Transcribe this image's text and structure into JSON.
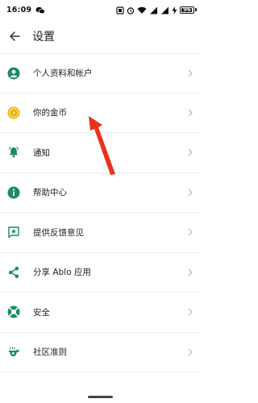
{
  "status_bar": {
    "time": "16:09",
    "battery_level": "96",
    "icons": [
      "wechat-icon",
      "notification-icon",
      "alarm-icon",
      "wifi-icon",
      "signal-icon",
      "signal-icon",
      "charging-icon",
      "battery-icon"
    ]
  },
  "header": {
    "title": "设置",
    "back_icon": "back-arrow-icon"
  },
  "accent_color": "#1b8a6b",
  "coin_color": "#e8b400",
  "annotation_color": "#e8321e",
  "menu": [
    {
      "label": "个人资料和帐户",
      "icon": "account-icon"
    },
    {
      "label": "你的金币",
      "icon": "coin-icon"
    },
    {
      "label": "通知",
      "icon": "bell-icon"
    },
    {
      "label": "帮助中心",
      "icon": "info-icon"
    },
    {
      "label": "提供反馈意见",
      "icon": "feedback-star-icon"
    },
    {
      "label": "分享 Ablo 应用",
      "icon": "share-icon"
    },
    {
      "label": "安全",
      "icon": "lifebuoy-icon"
    },
    {
      "label": "社区准则",
      "icon": "whistle-icon"
    }
  ]
}
